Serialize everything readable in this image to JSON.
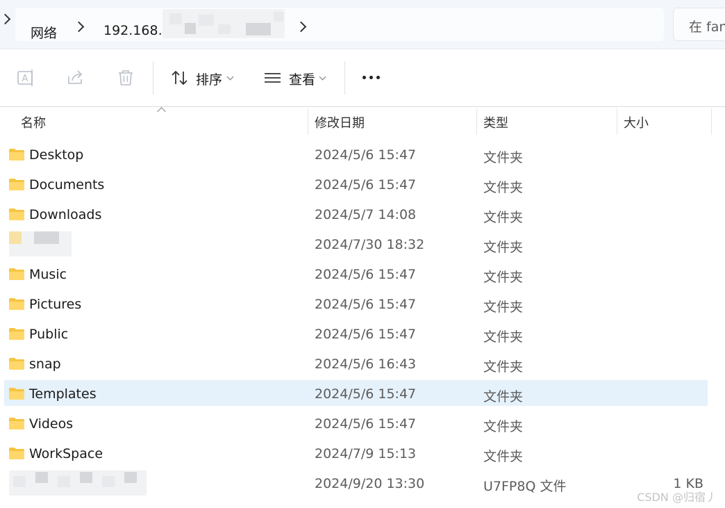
{
  "address_bar": {
    "crumbs": [
      "网络",
      "192.168.1"
    ],
    "search_placeholder": "在 fan"
  },
  "toolbar": {
    "sort_label": "排序",
    "view_label": "查看",
    "more_label": "..."
  },
  "columns": {
    "name": "名称",
    "date": "修改日期",
    "type": "类型",
    "size": "大小"
  },
  "files": [
    {
      "name": "Desktop",
      "date": "2024/5/6 15:47",
      "type": "文件夹",
      "size": "",
      "redacted": false,
      "selected": false
    },
    {
      "name": "Documents",
      "date": "2024/5/6 15:47",
      "type": "文件夹",
      "size": "",
      "redacted": false,
      "selected": false
    },
    {
      "name": "Downloads",
      "date": "2024/5/7 14:08",
      "type": "文件夹",
      "size": "",
      "redacted": false,
      "selected": false
    },
    {
      "name": "",
      "date": "2024/7/30 18:32",
      "type": "文件夹",
      "size": "",
      "redacted": true,
      "selected": false
    },
    {
      "name": "Music",
      "date": "2024/5/6 15:47",
      "type": "文件夹",
      "size": "",
      "redacted": false,
      "selected": false
    },
    {
      "name": "Pictures",
      "date": "2024/5/6 15:47",
      "type": "文件夹",
      "size": "",
      "redacted": false,
      "selected": false
    },
    {
      "name": "Public",
      "date": "2024/5/6 15:47",
      "type": "文件夹",
      "size": "",
      "redacted": false,
      "selected": false
    },
    {
      "name": "snap",
      "date": "2024/5/6 16:43",
      "type": "文件夹",
      "size": "",
      "redacted": false,
      "selected": false
    },
    {
      "name": "Templates",
      "date": "2024/5/6 15:47",
      "type": "文件夹",
      "size": "",
      "redacted": false,
      "selected": true
    },
    {
      "name": "Videos",
      "date": "2024/5/6 15:47",
      "type": "文件夹",
      "size": "",
      "redacted": false,
      "selected": false
    },
    {
      "name": "WorkSpace",
      "date": "2024/7/9 15:13",
      "type": "文件夹",
      "size": "",
      "redacted": false,
      "selected": false
    },
    {
      "name": "",
      "date": "2024/9/20 13:30",
      "type": "U7FP8Q 文件",
      "size": "1 KB",
      "redacted": true,
      "selected": false
    }
  ],
  "watermark": "CSDN @归宿丿",
  "colors": {
    "selection": "#e5f1fb",
    "folder": "#f5c542",
    "header_text": "#333333",
    "secondary_text": "#5c5c5c"
  }
}
